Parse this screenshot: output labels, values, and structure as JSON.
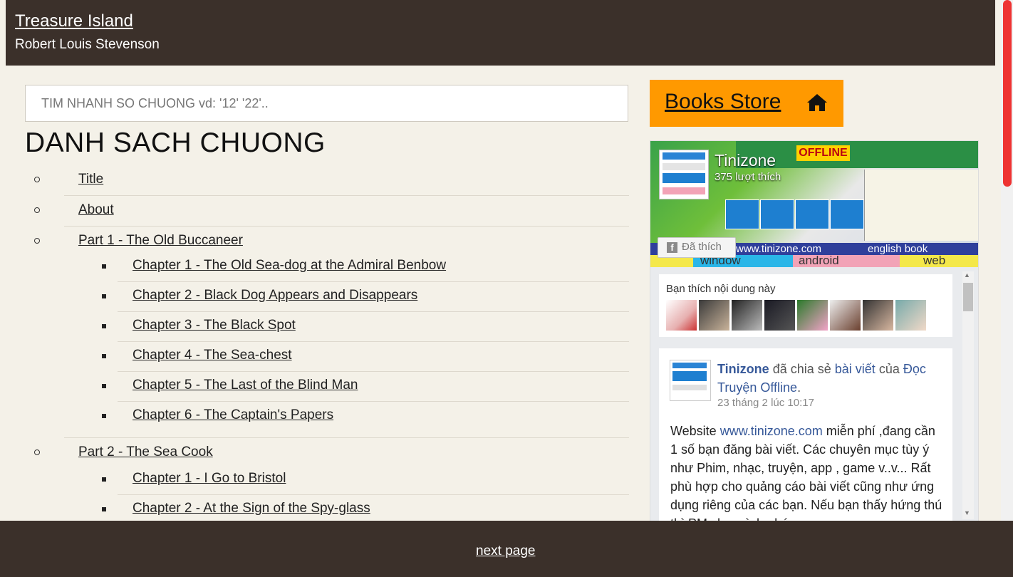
{
  "header": {
    "title": "Treasure Island",
    "author": "Robert Louis Stevenson"
  },
  "search": {
    "placeholder": "TIM NHANH SO CHUONG vd: '12' '22'.."
  },
  "toc": {
    "heading": "DANH SACH CHUONG",
    "items": [
      {
        "label": "Title"
      },
      {
        "label": "About"
      }
    ],
    "parts": [
      {
        "label": "Part 1 - The Old Buccaneer",
        "chapters": [
          "Chapter 1 - The Old Sea-dog at the Admiral Benbow",
          "Chapter 2 - Black Dog Appears and Disappears",
          "Chapter 3 - The Black Spot",
          "Chapter 4 - The Sea-chest",
          "Chapter 5 - The Last of the Blind Man",
          "Chapter 6 - The Captain's Papers"
        ]
      },
      {
        "label": "Part 2 - The Sea Cook",
        "chapters": [
          "Chapter 1 - I Go to Bristol",
          "Chapter 2 - At the Sign of the Spy-glass"
        ]
      }
    ]
  },
  "sidebar": {
    "books_store_label": "Books Store",
    "home_icon": "home-icon",
    "fb_page": {
      "name": "Tinizone",
      "likes": "375 lượt thích",
      "liked_button": "Đã thích",
      "cover_texts": [
        "www.tinizone.com",
        "english book",
        "window",
        "android",
        "web",
        "OFFLINE"
      ]
    },
    "friends": {
      "label": "Bạn thích nội dung này"
    },
    "post": {
      "author": "Tinizone",
      "shared": "đã chia sẻ",
      "link1": "bài viết",
      "of": "của",
      "page": "Đọc Truyện Offline",
      "dot": ".",
      "time": "23 tháng 2 lúc 10:17",
      "body_prefix": "Website ",
      "body_link": "www.tinizone.com",
      "body_rest": " miễn phí ,đang cần 1 số bạn đăng bài viết. Các chuyên mục tùy ý như Phim, nhạc, truyện, app , game v..v... Rất phù hợp cho quảng cáo bài viết cũng như ứng dụng riêng của các bạn. Nếu bạn thấy hứng thú thì PM cho mình nhé"
    }
  },
  "footer": {
    "next_label": "next page"
  },
  "colors": {
    "header_bg": "#3b302a",
    "page_bg": "#f4f1e8",
    "accent": "#ff9900",
    "scroll_thumb": "#ee3333"
  }
}
